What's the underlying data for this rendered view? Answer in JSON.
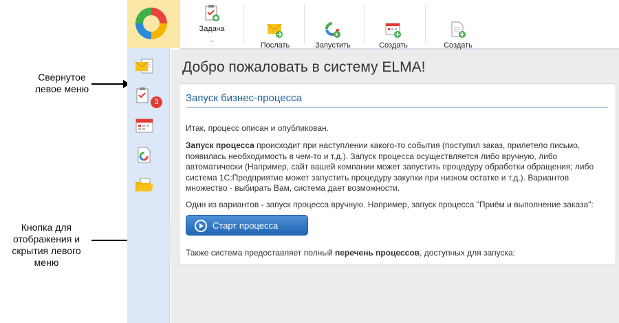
{
  "annotations": {
    "collapsed_menu": "Свернутое\nлевое меню",
    "toggle_button": "Кнопка для\nотображения и\nскрытия левого\nменю"
  },
  "toolbar": {
    "task": "Задача",
    "send_message": "Послать\nсообщение",
    "start_process": "Запустить\nпроцесс",
    "create_event": "Создать\nсобытие",
    "create_document": "Создать\nдокумент"
  },
  "sidebar": {
    "badge_count": "3"
  },
  "main": {
    "title": "Добро пожаловать в систему ELMA!",
    "card_title": "Запуск бизнес-процесса",
    "p1": "Итак, процесс описан и опубликован.",
    "p2_bold": "Запуск процесса",
    "p2_rest": " происходит при наступлении какого-то события (поступил заказ, прилетело письмо, появилась необходимость в чем-то и т.д.). Запуск процесса осуществляется либо вручную, либо автоматически (Например, сайт вашей компании может запустить процедуру обработки обращения; либо система 1С:Предприятие может запустить процедуру закупки при низком остатке и т.д.). Вариантов множество - выбирать Вам, система дает возможности.",
    "p3": "Один из вариантов - запуск процесса вручную. Например, запуск процесса \"Приём и выполнение заказа\":",
    "start_button": "Старт процесса",
    "p4_start": "Также система предоставляет полный ",
    "p4_bold": "перечень процессов",
    "p4_end": ", доступных для запуска:"
  }
}
